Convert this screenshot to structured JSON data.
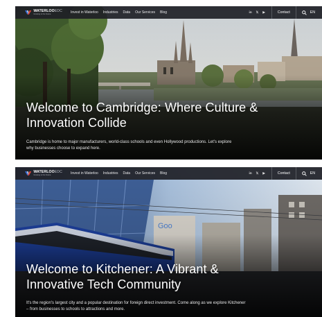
{
  "colors": {
    "navbar": "#1e2026",
    "logo_blue": "#3a6fd8",
    "logo_red": "#e0443a",
    "text": "#ffffff"
  },
  "nav": {
    "logo_name": "WATERLOO",
    "logo_suffix": "EDC",
    "logo_tagline": "Growing to the Future",
    "links": [
      "Invest in Waterloo",
      "Industries",
      "Data",
      "Our Services",
      "Blog"
    ],
    "social": [
      "in",
      "𝕏",
      "▶"
    ],
    "social_icons": [
      "linkedin-icon",
      "x-twitter-icon",
      "youtube-icon"
    ],
    "contact_label": "Contact",
    "search_icon": "search-icon",
    "language": "EN"
  },
  "heroes": [
    {
      "headline": "Welcome to Cambridge: Where Culture & Innovation Collide",
      "description": "Cambridge is home to major manufacturers, world-class schools and even Hollywood productions. Let's explore why businesses choose to expand here."
    },
    {
      "headline": "Welcome to Kitchener: A Vibrant & Innovative Tech Community",
      "description": "It's the region's largest city and a popular destination for foreign direct investment. Come along as we explore Kitchener – from businesses to schools to attractions and more."
    }
  ]
}
